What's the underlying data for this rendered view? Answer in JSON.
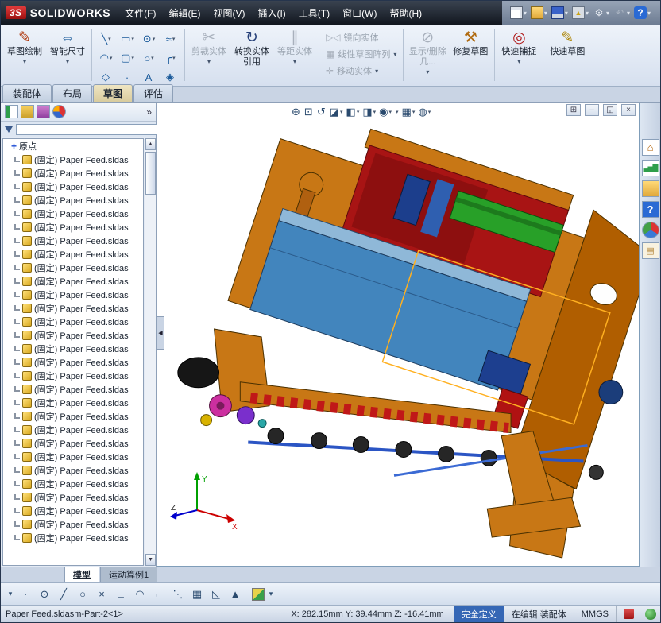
{
  "icons": {
    "dropdown": "▾",
    "origin": "+",
    "funnel": "filter-funnel",
    "collapse": "◀",
    "scroll_up": "▲",
    "scroll_down": "▼"
  },
  "colors": {
    "accent_orange": "#c87715",
    "model_red": "#a81414",
    "model_green": "#28a028",
    "model_blue": "#4285bd",
    "selection_highlight": "#ffb020",
    "status_blue": "#3567b5"
  },
  "titlebar": {
    "logo_badge": "3S",
    "logo_text": "SOLIDWORKS",
    "menus": [
      "文件(F)",
      "编辑(E)",
      "视图(V)",
      "插入(I)",
      "工具(T)",
      "窗口(W)",
      "帮助(H)"
    ],
    "quick_icons": [
      {
        "name": "new-document-icon",
        "cls": "qi qdoc",
        "glyph": "",
        "dd": "▾"
      },
      {
        "name": "open-icon",
        "cls": "qi qfolder",
        "glyph": "",
        "dd": "▾"
      },
      {
        "name": "save-icon",
        "cls": "qi qsave",
        "glyph": "",
        "dd": "▾"
      },
      {
        "name": "print-icon",
        "cls": "qi qprint",
        "glyph": "▲",
        "dd": "▾"
      },
      {
        "name": "options-gear-icon",
        "cls": "qi qgear",
        "glyph": "⚙",
        "dd": "▾"
      },
      {
        "name": "undo-icon",
        "cls": "qi qundo",
        "glyph": "↶",
        "dd": "▾"
      },
      {
        "name": "help-icon",
        "cls": "qi qhelp",
        "glyph": "?",
        "dd": "▾"
      }
    ]
  },
  "ribbon": {
    "sketch_draw": {
      "label": "草图绘制",
      "icon": "✎"
    },
    "smart_dimension": {
      "label": "智能尺寸",
      "icon": "⇔"
    },
    "entity_grid": [
      {
        "name": "line-tool-icon",
        "glyph": "╲",
        "dd": "▾"
      },
      {
        "name": "rectangle-tool-icon",
        "glyph": "▭",
        "dd": "▾"
      },
      {
        "name": "circle-tool-icon",
        "glyph": "⊙",
        "dd": "▾"
      },
      {
        "name": "spline-tool-icon",
        "glyph": "≈",
        "dd": "▾"
      },
      {
        "name": "arc-tool-icon",
        "glyph": "◠",
        "dd": "▾"
      },
      {
        "name": "slot-tool-icon",
        "glyph": "▢",
        "dd": "▾"
      },
      {
        "name": "ellipse-tool-icon",
        "glyph": "○",
        "dd": "▾"
      },
      {
        "name": "fillet-tool-icon",
        "glyph": "╭",
        "dd": "▾"
      },
      {
        "name": "polygon-tool-icon",
        "glyph": "◇"
      },
      {
        "name": "point-tool-icon",
        "glyph": "·"
      },
      {
        "name": "text-tool-icon",
        "glyph": "A"
      },
      {
        "name": "plane-tool-icon",
        "glyph": "◈"
      }
    ],
    "trim": {
      "label": "剪裁实体",
      "icon": "✂",
      "state": "disabled"
    },
    "convert": {
      "label": "转换实体引用",
      "icon": "↻"
    },
    "offset": {
      "label": "等距实体",
      "icon": "∥",
      "state": "disabled"
    },
    "mirror": {
      "label": "镜向实体",
      "icon": "▷◁",
      "state": "disabled"
    },
    "linear_pattern": {
      "label": "线性草图阵列",
      "icon": "▦",
      "state": "disabled"
    },
    "move": {
      "label": "移动实体",
      "icon": "✛",
      "state": "disabled"
    },
    "display_delete": {
      "label": "显示/删除几...",
      "icon": "⊘",
      "state": "disabled"
    },
    "repair": {
      "label": "修复草图",
      "icon": "⚒"
    },
    "quick_snaps": {
      "label": "快速捕捉",
      "icon": "◎"
    },
    "quick_sketch": {
      "label": "快速草图",
      "icon": "✎"
    }
  },
  "command_tabs": [
    {
      "label": "装配体"
    },
    {
      "label": "布局"
    },
    {
      "label": "草图",
      "active": true
    },
    {
      "label": "评估"
    }
  ],
  "viewbar": [
    {
      "name": "zoom-fit-icon",
      "glyph": "⊕"
    },
    {
      "name": "zoom-area-icon",
      "glyph": "⊡"
    },
    {
      "name": "previous-view-icon",
      "glyph": "↺"
    },
    {
      "name": "section-view-icon",
      "glyph": "◪",
      "dd": "▾"
    },
    {
      "name": "view-orientation-icon",
      "glyph": "◧",
      "dd": "▾"
    },
    {
      "name": "display-style-icon",
      "glyph": "◨",
      "dd": "▾"
    },
    {
      "name": "hide-show-items-icon",
      "glyph": "◉",
      "dd": "▾"
    },
    {
      "name": "edit-appearance-icon",
      "glyph": "",
      "ball": "ballg",
      "dd": "▾"
    },
    {
      "name": "apply-scene-icon",
      "glyph": "▦",
      "dd": "▾"
    },
    {
      "name": "view-settings-icon",
      "glyph": "◍",
      "dd": "▾"
    }
  ],
  "window_controls": [
    {
      "name": "tile-window-icon",
      "glyph": "⊞"
    },
    {
      "name": "minimize-window-icon",
      "glyph": "–"
    },
    {
      "name": "restore-window-icon",
      "glyph": "◱"
    },
    {
      "name": "close-window-icon",
      "glyph": "×"
    }
  ],
  "taskpane": [
    {
      "name": "resources-home-icon",
      "cls": "tp tph",
      "glyph": "⌂"
    },
    {
      "name": "design-library-icon",
      "cls": "tp tpc",
      "glyph": "▃▅▇"
    },
    {
      "name": "file-explorer-icon",
      "cls": "tp tpf",
      "glyph": ""
    },
    {
      "name": "search-help-icon",
      "cls": "tp tpq",
      "glyph": "?"
    },
    {
      "name": "appearances-scenes-icon",
      "cls": "tp tpb",
      "glyph": ""
    },
    {
      "name": "custom-properties-icon",
      "cls": "tp tpd",
      "glyph": "▤"
    }
  ],
  "tree": {
    "expand_label": "»",
    "origin_label": "原点",
    "items": [
      "(固定) Paper Feed.sldas",
      "(固定) Paper Feed.sldas",
      "(固定) Paper Feed.sldas",
      "(固定) Paper Feed.sldas",
      "(固定) Paper Feed.sldas",
      "(固定) Paper Feed.sldas",
      "(固定) Paper Feed.sldas",
      "(固定) Paper Feed.sldas",
      "(固定) Paper Feed.sldas",
      "(固定) Paper Feed.sldas",
      "(固定) Paper Feed.sldas",
      "(固定) Paper Feed.sldas",
      "(固定) Paper Feed.sldas",
      "(固定) Paper Feed.sldas",
      "(固定) Paper Feed.sldas",
      "(固定) Paper Feed.sldas",
      "(固定) Paper Feed.sldas",
      "(固定) Paper Feed.sldas",
      "(固定) Paper Feed.sldas",
      "(固定) Paper Feed.sldas",
      "(固定) Paper Feed.sldas",
      "(固定) Paper Feed.sldas",
      "(固定) Paper Feed.sldas",
      "(固定) Paper Feed.sldas",
      "(固定) Paper Feed.sldas",
      "(固定) Paper Feed.sldas",
      "(固定) Paper Feed.sldas",
      "(固定) Paper Feed.sldas",
      "(固定) Paper Feed.sldas"
    ]
  },
  "bottom_tabs": [
    {
      "label": "模型",
      "active": true
    },
    {
      "label": "运动算例1"
    }
  ],
  "sketchbar": [
    {
      "name": "flyout-dropdown-icon",
      "cls": "sk sm",
      "glyph": "▾"
    },
    {
      "name": "sketch-point-icon",
      "cls": "sk",
      "glyph": "·"
    },
    {
      "name": "sketch-circle-icon",
      "cls": "sk",
      "glyph": "⊙"
    },
    {
      "name": "sketch-line-icon",
      "cls": "sk",
      "glyph": "╱"
    },
    {
      "name": "sketch-ellipse-icon",
      "cls": "sk",
      "glyph": "○"
    },
    {
      "name": "sketch-trim-icon",
      "cls": "sk",
      "glyph": "×"
    },
    {
      "name": "sketch-right-angle-icon",
      "cls": "sk",
      "glyph": "∟"
    },
    {
      "name": "sketch-arc-icon",
      "cls": "sk",
      "glyph": "◠"
    },
    {
      "name": "sketch-corner-icon",
      "cls": "sk",
      "glyph": "⌐"
    },
    {
      "name": "sketch-pattern-icon",
      "cls": "sk",
      "glyph": "⋱"
    },
    {
      "name": "sketch-grid-icon",
      "cls": "sk",
      "glyph": "▦"
    },
    {
      "name": "sketch-chamfer-icon",
      "cls": "sk",
      "glyph": "◺"
    },
    {
      "name": "sketch-plane-icon",
      "cls": "sk",
      "glyph": "▲"
    },
    {
      "name": "color-swatch-icon",
      "cls": "sk chip",
      "glyph": ""
    },
    {
      "name": "more-tools-dropdown-icon",
      "cls": "sk sm",
      "glyph": "▾"
    }
  ],
  "statusbar": {
    "filename": "Paper Feed.sldasm-Part-2<1>",
    "coords": "X: 282.15mm Y: 39.44mm Z: -16.41mm",
    "state": "完全定义",
    "edit_mode": "在编辑 装配体",
    "units": "MMGS"
  },
  "triad": {
    "x": "X",
    "y": "Y",
    "z": "Z"
  }
}
